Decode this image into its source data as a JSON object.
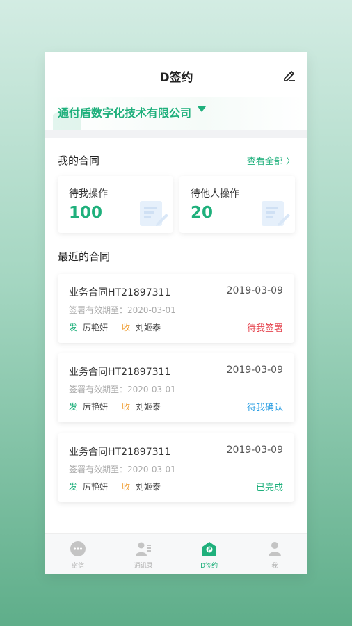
{
  "header": {
    "title": "D签约"
  },
  "company": {
    "name": "通付盾数字化技术有限公司"
  },
  "my_contracts": {
    "title": "我的合同",
    "view_all": "查看全部 〉",
    "cards": [
      {
        "label": "待我操作",
        "value": "100"
      },
      {
        "label": "待他人操作",
        "value": "20"
      }
    ]
  },
  "recent": {
    "title": "最近的合同",
    "contracts": [
      {
        "name": "业务合同HT21897311",
        "date": "2019-03-09",
        "expiry": "签署有效期至：2020-03-01",
        "send_tag": "发",
        "sender": "厉艳妍",
        "recv_tag": "收",
        "receiver": "刘姬泰",
        "status": "待我签署",
        "status_color": "#e5454f"
      },
      {
        "name": "业务合同HT21897311",
        "date": "2019-03-09",
        "expiry": "签署有效期至：2020-03-01",
        "send_tag": "发",
        "sender": "厉艳妍",
        "recv_tag": "收",
        "receiver": "刘姬泰",
        "status": "待我确认",
        "status_color": "#2a9ee3"
      },
      {
        "name": "业务合同HT21897311",
        "date": "2019-03-09",
        "expiry": "签署有效期至：2020-03-01",
        "send_tag": "发",
        "sender": "厉艳妍",
        "recv_tag": "收",
        "receiver": "刘姬泰",
        "status": "已完成",
        "status_color": "#1fb07c"
      }
    ]
  },
  "tabbar": {
    "items": [
      {
        "label": "密信",
        "icon": "chat-icon"
      },
      {
        "label": "通讯录",
        "icon": "contacts-icon"
      },
      {
        "label": "D签约",
        "icon": "sign-icon",
        "active": true
      },
      {
        "label": "我",
        "icon": "profile-icon"
      }
    ]
  },
  "colors": {
    "accent": "#1fb07c",
    "danger": "#e5454f",
    "info": "#2a9ee3",
    "warn": "#f0a13a"
  }
}
